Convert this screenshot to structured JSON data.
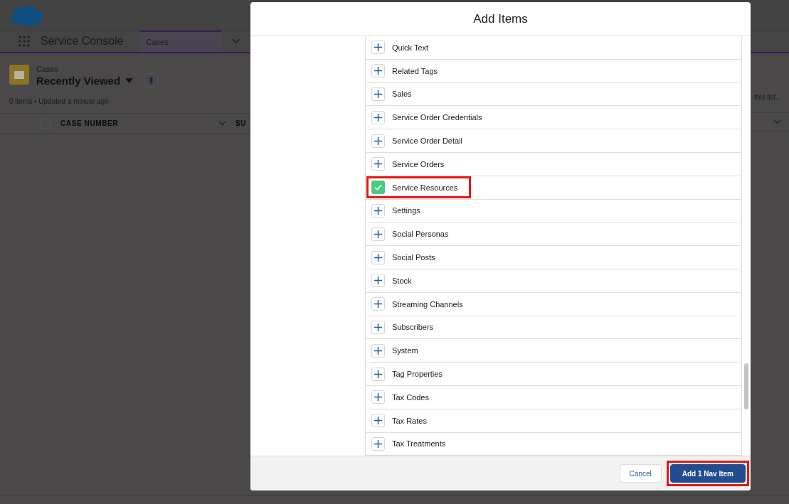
{
  "app": {
    "name": "Service Console",
    "tabs": [
      {
        "label": "Cases",
        "selected": true
      }
    ]
  },
  "list_view": {
    "object": "Cases",
    "title": "Recently Viewed",
    "status": "0 items • Updated a minute ago",
    "search_placeholder": "this list...",
    "select_all_checked": false,
    "columns": [
      "CASE NUMBER",
      "SU"
    ]
  },
  "modal": {
    "title": "Add Items",
    "items": [
      {
        "label": "Quick Text",
        "added": false,
        "highlighted": false
      },
      {
        "label": "Related Tags",
        "added": false,
        "highlighted": false
      },
      {
        "label": "Sales",
        "added": false,
        "highlighted": false
      },
      {
        "label": "Service Order Credentials",
        "added": false,
        "highlighted": false
      },
      {
        "label": "Service Order Detail",
        "added": false,
        "highlighted": false
      },
      {
        "label": "Service Orders",
        "added": false,
        "highlighted": false
      },
      {
        "label": "Service Resources",
        "added": true,
        "highlighted": true
      },
      {
        "label": "Settings",
        "added": false,
        "highlighted": false
      },
      {
        "label": "Social Personas",
        "added": false,
        "highlighted": false
      },
      {
        "label": "Social Posts",
        "added": false,
        "highlighted": false
      },
      {
        "label": "Stock",
        "added": false,
        "highlighted": false
      },
      {
        "label": "Streaming Channels",
        "added": false,
        "highlighted": false
      },
      {
        "label": "Subscribers",
        "added": false,
        "highlighted": false
      },
      {
        "label": "System",
        "added": false,
        "highlighted": false
      },
      {
        "label": "Tag Properties",
        "added": false,
        "highlighted": false
      },
      {
        "label": "Tax Codes",
        "added": false,
        "highlighted": false
      },
      {
        "label": "Tax Rates",
        "added": false,
        "highlighted": false
      },
      {
        "label": "Tax Treatments",
        "added": false,
        "highlighted": false
      }
    ],
    "buttons": [
      {
        "label": "Cancel",
        "kind": "neutral",
        "highlighted": false
      },
      {
        "label": "Add 1 Nav Item",
        "kind": "brand",
        "highlighted": true
      }
    ]
  }
}
